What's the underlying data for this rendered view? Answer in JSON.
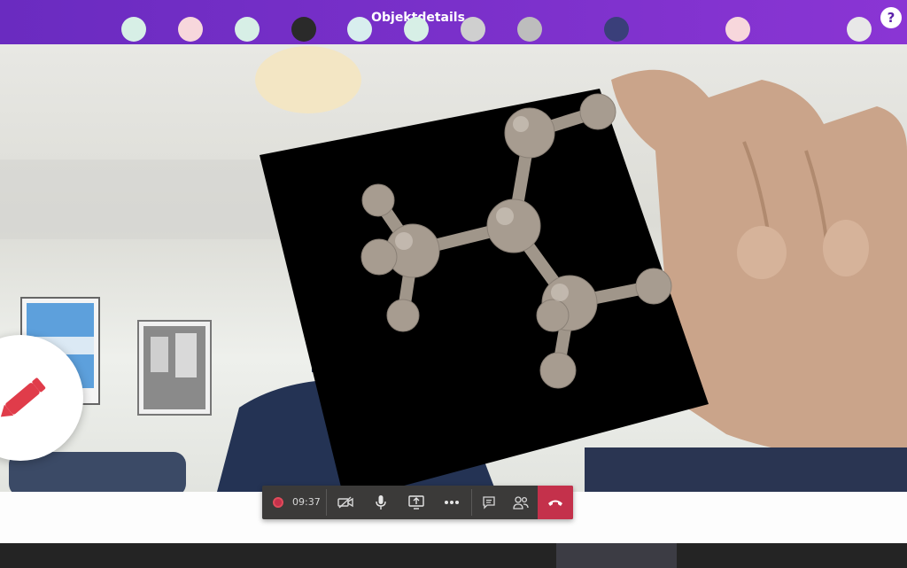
{
  "header": {
    "title": "Objektdetails",
    "help_label": "?"
  },
  "call_controls": {
    "timer": "09:37"
  },
  "icons": {
    "help": "question-icon",
    "pencil": "pencil-icon",
    "record": "record-dot-icon",
    "video_off": "video-off-icon",
    "mic": "microphone-icon",
    "share": "share-screen-icon",
    "more": "more-icon",
    "chat": "chat-icon",
    "people": "participants-icon",
    "hangup": "hang-up-icon"
  },
  "colors": {
    "header": "#7a30cc",
    "hangup": "#c4314b",
    "pencil": "#e03c4a"
  },
  "participants": [
    {
      "color": "#d7efe6"
    },
    {
      "color": "#f7d7dc"
    },
    {
      "color": "#d7efe6"
    },
    {
      "color": "#2a2a2a"
    },
    {
      "color": "#d8eeee"
    },
    {
      "color": "#d7efe6"
    },
    {
      "color": "#cfcfcf"
    },
    {
      "color": "#bdbdbd"
    },
    {
      "color": "#3a3f7a"
    },
    {
      "color": "#f7d7dc"
    },
    {
      "color": "#e8e8e8"
    }
  ]
}
